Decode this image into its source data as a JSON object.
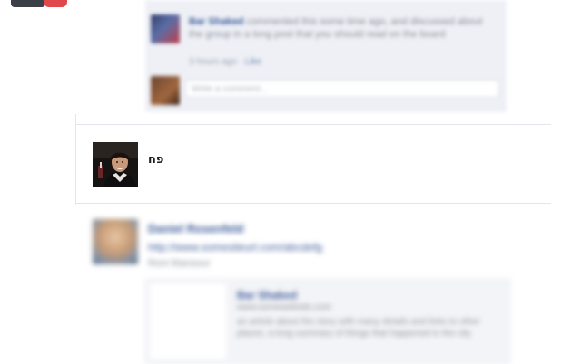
{
  "comment": {
    "author": "Bar Shaked",
    "text": "commented this some time ago, and discussed about the group in a long post that you should read on the board",
    "meta_time": "3 hours ago",
    "meta_like": "Like",
    "reply_placeholder": "Write a comment..."
  },
  "shared": {
    "person_name": "פח"
  },
  "story": {
    "author": "Daniel Rosenfeld",
    "link": "http://www.somesiteurl.com/abcdefg",
    "subtitle": "Roni Mansour",
    "attachment": {
      "title": "Bar Shaked",
      "meta": "www.somewebsite.com",
      "description": "an article about the story with many details and links to other places, a long summary of things that happened in the city"
    }
  }
}
